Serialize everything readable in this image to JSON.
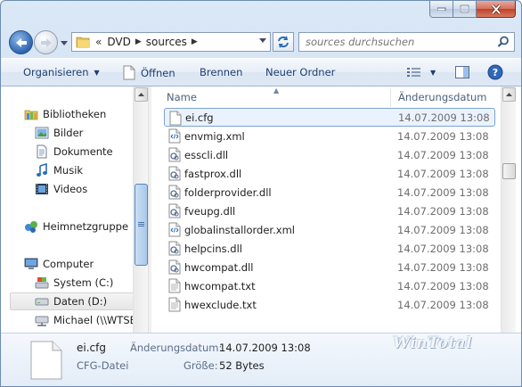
{
  "window": {
    "caption_buttons": [
      "minimize",
      "maximize",
      "close"
    ]
  },
  "navigation": {
    "breadcrumb_prefix": "«",
    "breadcrumb": [
      "DVD",
      "sources"
    ],
    "search_placeholder": "sources durchsuchen"
  },
  "toolbar": {
    "organize_label": "Organisieren",
    "open_label": "Öffnen",
    "burn_label": "Brennen",
    "new_folder_label": "Neuer Ordner",
    "views_icon": "details-view-icon",
    "preview_icon": "preview-pane-icon",
    "help_icon": "help-icon"
  },
  "sidebar": {
    "items": [
      {
        "label": "Bibliotheken",
        "icon": "libraries-icon"
      },
      {
        "label": "Bilder",
        "icon": "pictures-icon"
      },
      {
        "label": "Dokumente",
        "icon": "documents-icon"
      },
      {
        "label": "Musik",
        "icon": "music-icon"
      },
      {
        "label": "Videos",
        "icon": "videos-icon"
      },
      {
        "label": "Heimnetzgruppe",
        "icon": "homegroup-icon"
      },
      {
        "label": "Computer",
        "icon": "computer-icon"
      },
      {
        "label": "System (C:)",
        "icon": "drive-icon"
      },
      {
        "label": "Daten (D:)",
        "icon": "drive-icon"
      },
      {
        "label": "Michael (\\\\WTSE",
        "icon": "network-drive-icon"
      }
    ]
  },
  "file_list": {
    "columns": {
      "name": "Name",
      "date": "Änderungsdatum"
    },
    "rows": [
      {
        "name": "ei.cfg",
        "date": "14.07.2009 13:08",
        "icon": "blank-file-icon",
        "selected": true
      },
      {
        "name": "envmig.xml",
        "date": "14.07.2009 13:08",
        "icon": "xml-file-icon"
      },
      {
        "name": "esscli.dll",
        "date": "14.07.2009 13:08",
        "icon": "dll-file-icon"
      },
      {
        "name": "fastprox.dll",
        "date": "14.07.2009 13:08",
        "icon": "dll-file-icon"
      },
      {
        "name": "folderprovider.dll",
        "date": "14.07.2009 13:08",
        "icon": "dll-file-icon"
      },
      {
        "name": "fveupg.dll",
        "date": "14.07.2009 13:08",
        "icon": "dll-file-icon"
      },
      {
        "name": "globalinstallorder.xml",
        "date": "14.07.2009 13:08",
        "icon": "xml-file-icon"
      },
      {
        "name": "helpcins.dll",
        "date": "14.07.2009 13:08",
        "icon": "dll-file-icon"
      },
      {
        "name": "hwcompat.dll",
        "date": "14.07.2009 13:08",
        "icon": "dll-file-icon"
      },
      {
        "name": "hwcompat.txt",
        "date": "14.07.2009 13:08",
        "icon": "text-file-icon"
      },
      {
        "name": "hwexclude.txt",
        "date": "14.07.2009 13:08",
        "icon": "text-file-icon"
      }
    ]
  },
  "details": {
    "name": "ei.cfg",
    "type": "CFG-Datei",
    "modified_label": "Änderungsdatum:",
    "modified_value": "14.07.2009 13:08",
    "size_label": "Größe:",
    "size_value": "52 Bytes",
    "watermark": "WinTotal"
  }
}
